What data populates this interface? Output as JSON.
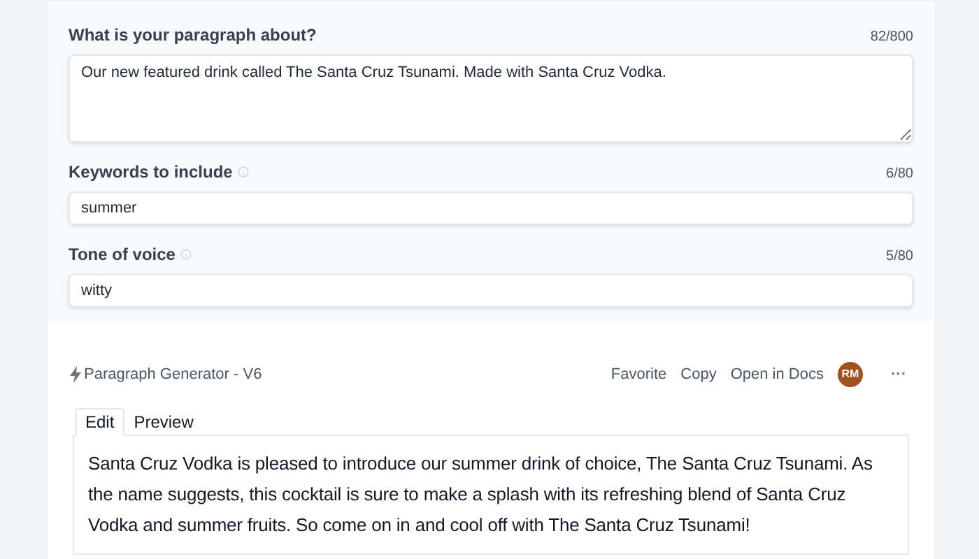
{
  "fields": [
    {
      "kind": "textarea",
      "label": "What is your paragraph about?",
      "info": false,
      "count": "82/800",
      "value": "Our new featured drink called The Santa Cruz Tsunami. Made with Santa Cruz Vodka."
    },
    {
      "kind": "input",
      "label": "Keywords to include",
      "info": true,
      "count": "6/80",
      "value": "summer"
    },
    {
      "kind": "input",
      "label": "Tone of voice",
      "info": true,
      "count": "5/80",
      "value": "witty"
    }
  ],
  "result": {
    "title": "Paragraph Generator - V6",
    "actions": [
      "Favorite",
      "Copy",
      "Open in Docs"
    ],
    "avatar": "RM",
    "more": "···",
    "tabs": [
      {
        "label": "Edit",
        "selected": true
      },
      {
        "label": "Preview",
        "selected": false
      }
    ],
    "output": "Santa Cruz Vodka is pleased to introduce our summer drink of choice, The Santa Cruz Tsunami. As the name suggests, this cocktail is sure to make a splash with its refreshing blend of Santa Cruz Vodka and summer fruits. So come on in and cool off with The Santa Cruz Tsunami!"
  }
}
